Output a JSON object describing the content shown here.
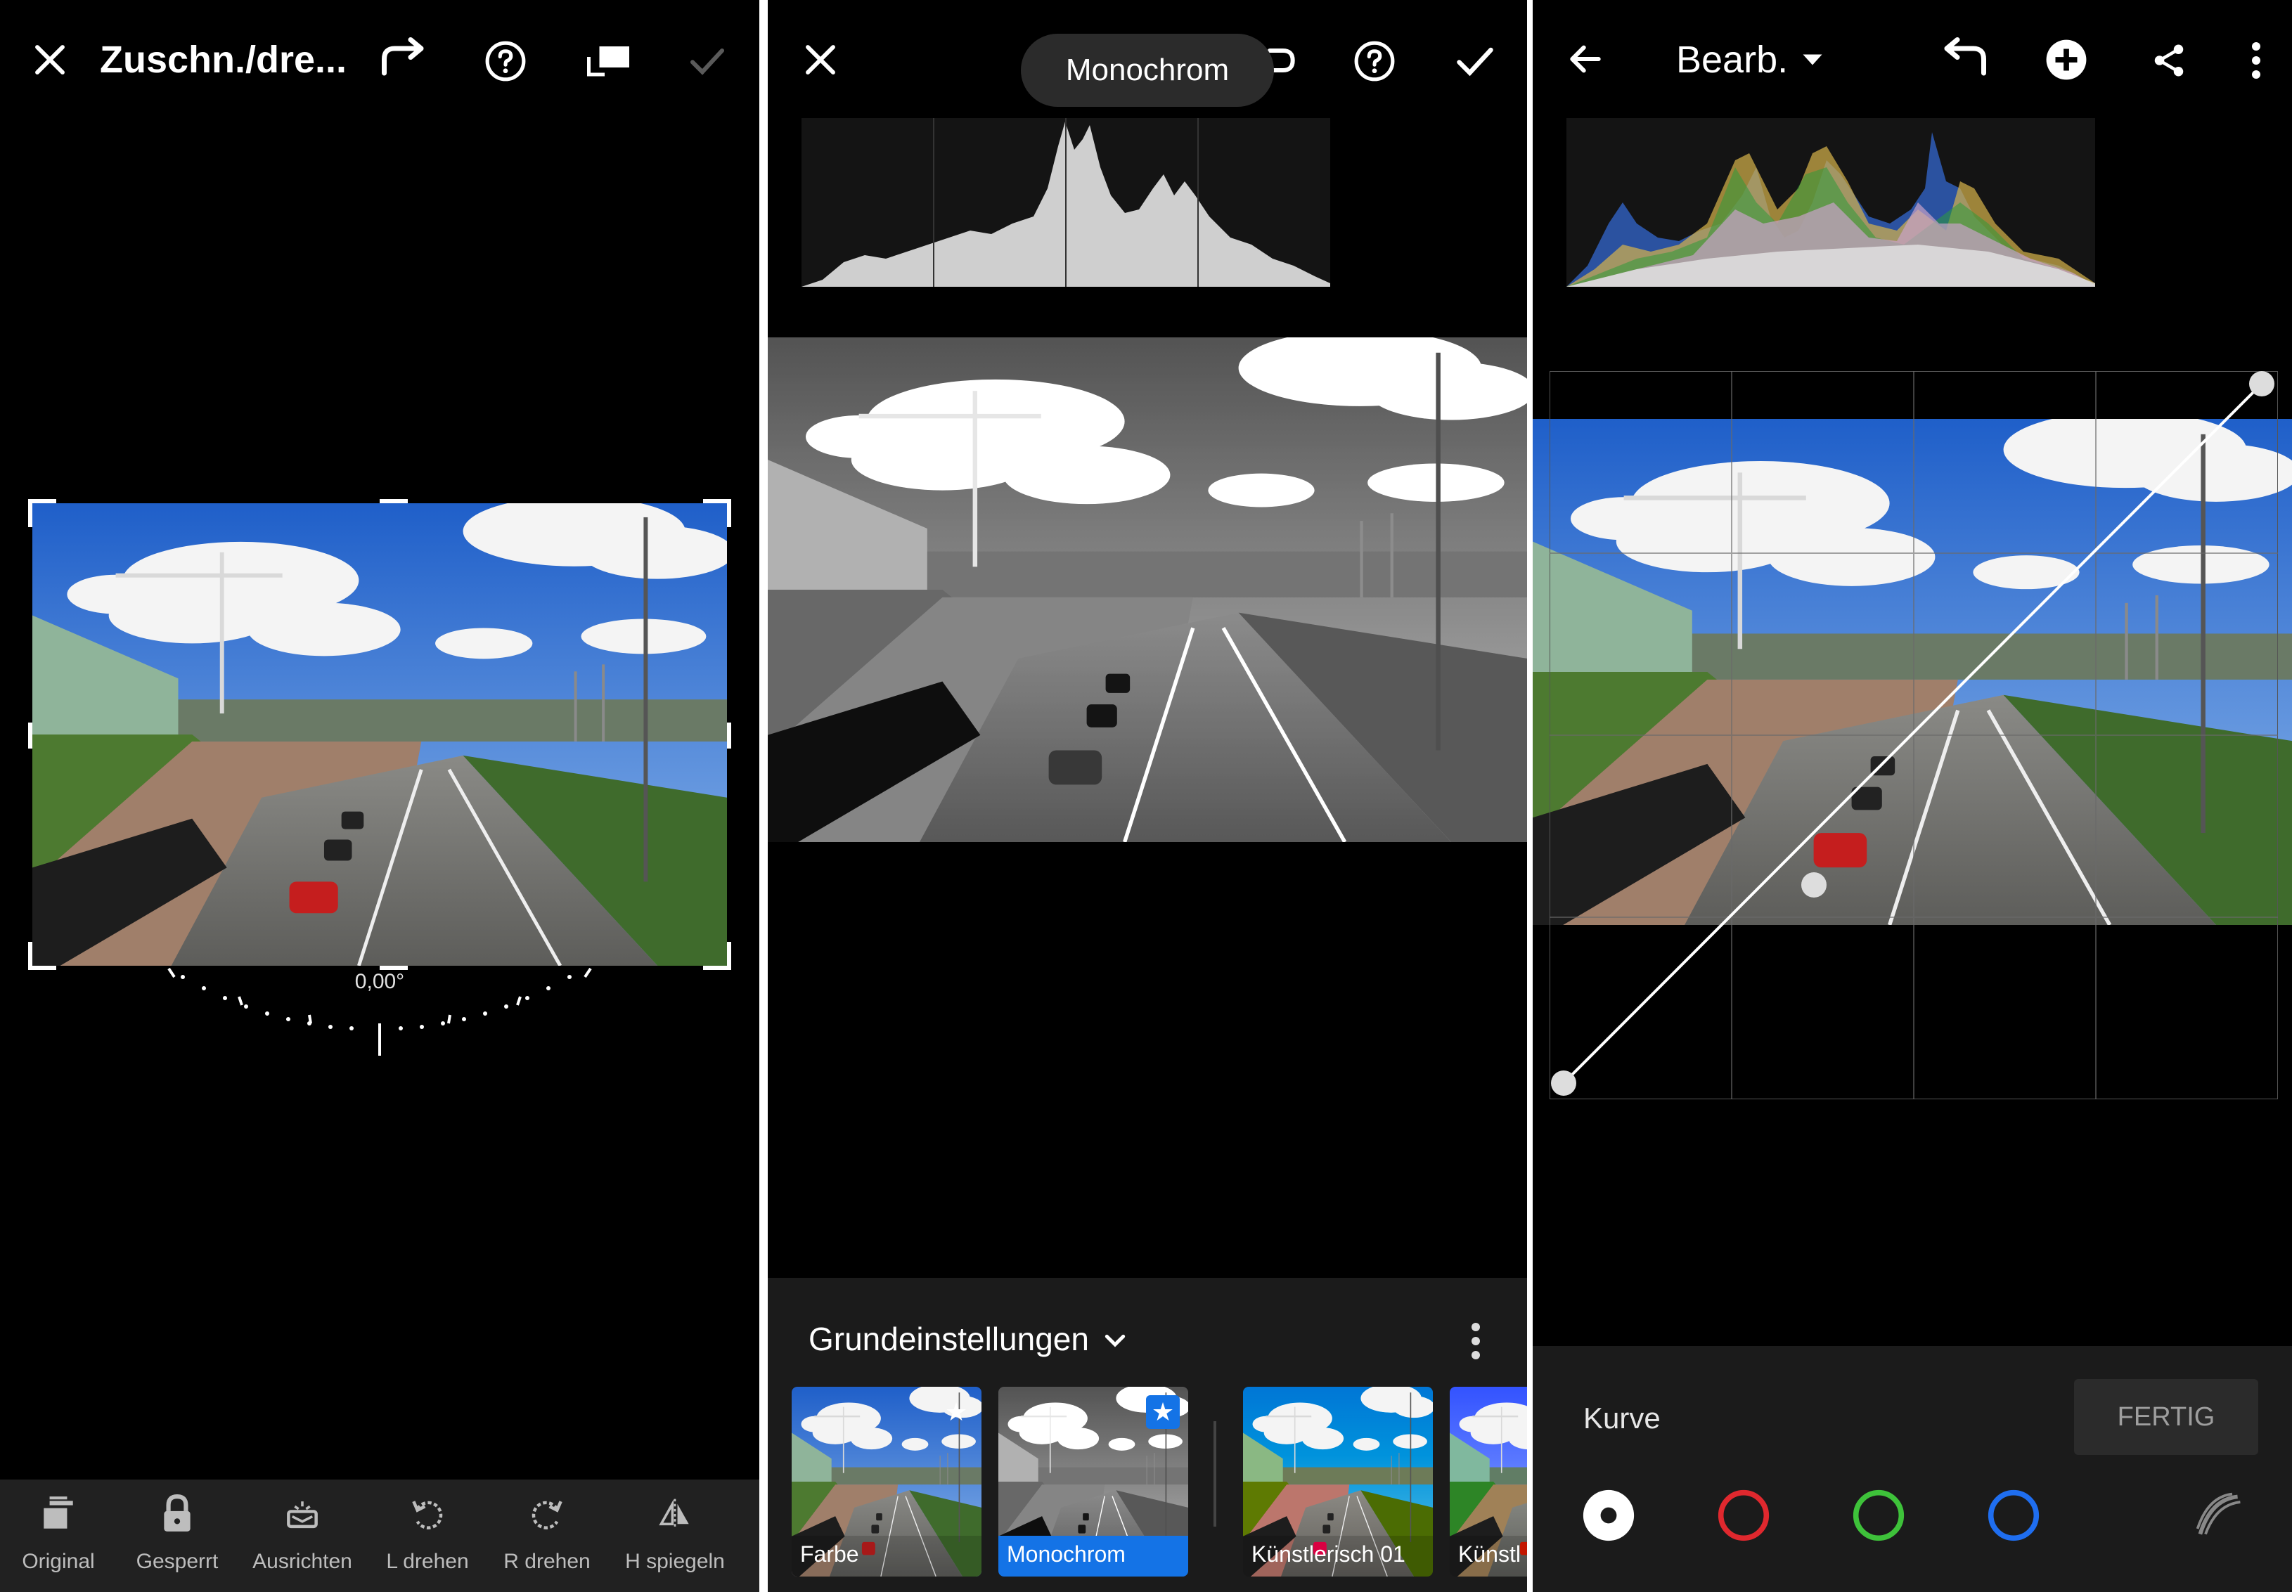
{
  "panel1": {
    "title": "Zuschn./dre...",
    "angle": "0,00°",
    "tools": [
      {
        "label": "Original",
        "icon": "original-icon"
      },
      {
        "label": "Gesperrt",
        "icon": "lock-icon"
      },
      {
        "label": "Ausrichten",
        "icon": "auto-align-icon"
      },
      {
        "label": "L drehen",
        "icon": "rotate-left-icon"
      },
      {
        "label": "R drehen",
        "icon": "rotate-right-icon"
      },
      {
        "label": "H spiegeln",
        "icon": "flip-horizontal-icon"
      }
    ]
  },
  "panel2": {
    "tooltip": "Monochrom",
    "category": "Grundeinstellungen",
    "presets": [
      {
        "label": "Farbe",
        "selected": false,
        "favorite": true,
        "style": "color"
      },
      {
        "label": "Monochrom",
        "selected": true,
        "favorite": true,
        "style": "mono"
      },
      {
        "label": "Künstlerisch 01",
        "selected": false,
        "favorite": false,
        "style": "artistic"
      },
      {
        "label": "Künstl",
        "selected": false,
        "favorite": false,
        "style": "artistic"
      }
    ]
  },
  "panel3": {
    "title": "Bearb.",
    "section_label": "Kurve",
    "done_label": "FERTIG",
    "channels": [
      {
        "name": "parametric",
        "color": "#ffffff",
        "selected": true
      },
      {
        "name": "red",
        "color": "#e0282e",
        "selected": false
      },
      {
        "name": "green",
        "color": "#3ec23a",
        "selected": false
      },
      {
        "name": "blue",
        "color": "#1f6ef0",
        "selected": false
      }
    ]
  },
  "colors": {
    "accent": "#1473e6",
    "background": "#000000",
    "toolbar": "#212121"
  }
}
